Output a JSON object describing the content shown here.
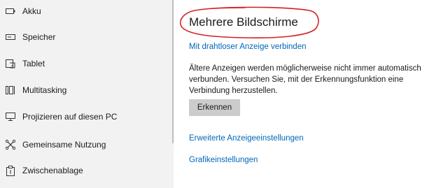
{
  "sidebar": {
    "items": [
      {
        "label": "Akku",
        "icon": "battery-icon"
      },
      {
        "label": "Speicher",
        "icon": "storage-icon"
      },
      {
        "label": "Tablet",
        "icon": "tablet-icon"
      },
      {
        "label": "Multitasking",
        "icon": "multitasking-icon"
      },
      {
        "label": "Projizieren auf diesen PC",
        "icon": "project-to-pc-icon"
      },
      {
        "label": "Gemeinsame Nutzung",
        "icon": "shared-experiences-icon"
      },
      {
        "label": "Zwischenablage",
        "icon": "clipboard-icon"
      }
    ]
  },
  "main": {
    "title": "Mehrere Bildschirme",
    "wireless_link": "Mit drahtloser Anzeige verbinden",
    "description": "Ältere Anzeigen werden möglicherweise nicht immer automatisch verbunden. Versuchen Sie, mit der Erkennungsfunktion eine Verbindung herzustellen.",
    "detect_button": "Erkennen",
    "advanced_link": "Erweiterte Anzeigeeinstellungen",
    "graphics_link": "Grafikeinstellungen"
  },
  "colors": {
    "sidebar_bg": "#f2f2f2",
    "link": "#0067b8",
    "annotation_red": "#d42020",
    "button_bg": "#cccccc"
  }
}
